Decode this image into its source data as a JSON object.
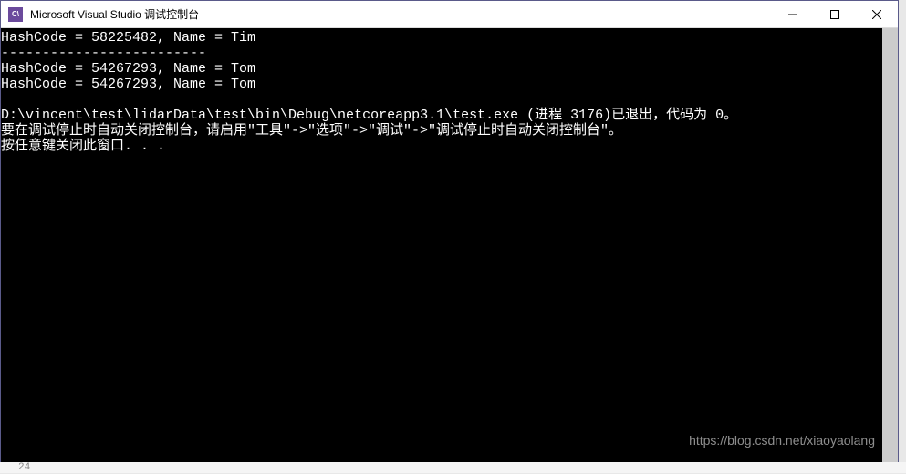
{
  "titlebar": {
    "icon_text": "C\\",
    "title": "Microsoft Visual Studio 调试控制台"
  },
  "console": {
    "lines": [
      "HashCode = 58225482, Name = Tim",
      "-------------------------",
      "HashCode = 54267293, Name = Tom",
      "HashCode = 54267293, Name = Tom",
      "",
      "D:\\vincent\\test\\lidarData\\test\\bin\\Debug\\netcoreapp3.1\\test.exe (进程 3176)已退出，代码为 0。",
      "要在调试停止时自动关闭控制台，请启用\"工具\"->\"选项\"->\"调试\"->\"调试停止时自动关闭控制台\"。",
      "按任意键关闭此窗口. . ."
    ]
  },
  "watermark": {
    "text": "https://blog.csdn.net/xiaoyaolang"
  },
  "bottom": {
    "text": "24"
  }
}
